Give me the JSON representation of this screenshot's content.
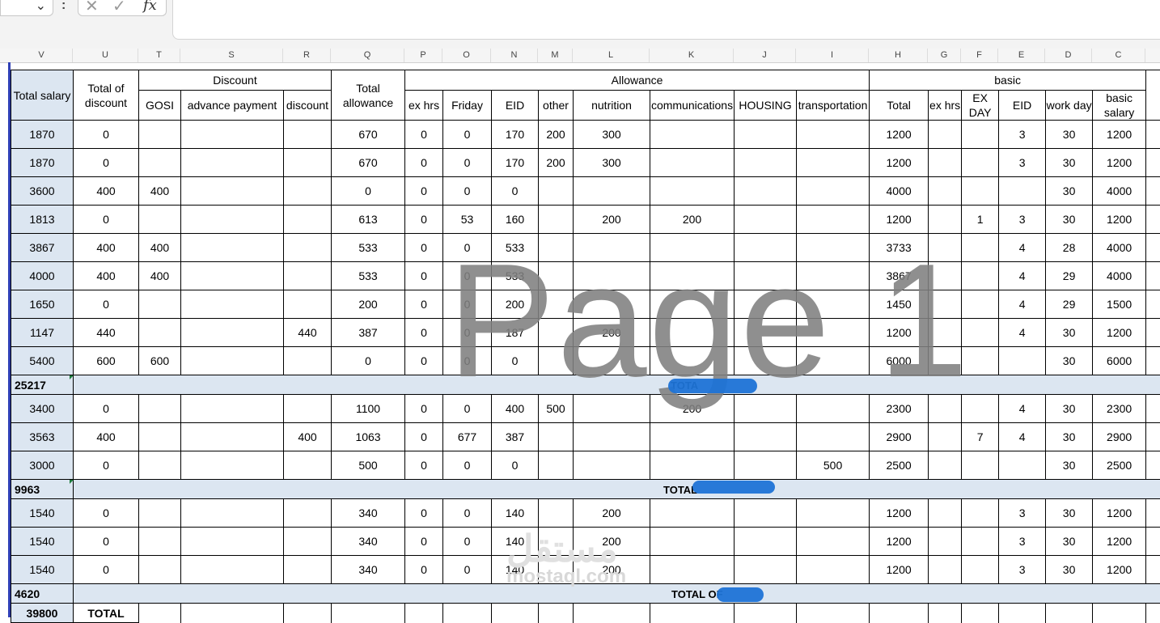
{
  "formula_bar": {
    "fx_label": "fx",
    "cancel_glyph": "✕",
    "enter_glyph": "✓",
    "name_box_value": ""
  },
  "columns": [
    "V",
    "U",
    "T",
    "S",
    "R",
    "Q",
    "P",
    "O",
    "N",
    "M",
    "L",
    "K",
    "J",
    "I",
    "H",
    "G",
    "F",
    "E",
    "D",
    "C"
  ],
  "headers": {
    "total_salary": "Total salary",
    "total_of_discount": "Total of discount",
    "discount_group": "Discount",
    "gosi": "GOSI",
    "advance_payment": "advance payment",
    "discount": "discount",
    "total_allowance": "Total allowance",
    "allowance_group": "Allowance",
    "ex_hrs": "ex hrs",
    "friday": "Friday",
    "eid": "EID",
    "other": "other",
    "nutrition": "nutrition",
    "communications": "communications",
    "housing": "HOUSING",
    "transportation": "transportation",
    "basic_group": "basic",
    "total": "Total",
    "ex_hrs_basic": "ex hrs",
    "ex_day": "EX DAY",
    "eid_basic": "EID",
    "work_day": "work day",
    "basic_salary": "basic salary"
  },
  "rows": [
    [
      "1870",
      "0",
      "",
      "",
      "",
      "670",
      "0",
      "0",
      "170",
      "200",
      "300",
      "",
      "",
      "",
      "1200",
      "",
      "",
      "3",
      "30",
      "1200"
    ],
    [
      "1870",
      "0",
      "",
      "",
      "",
      "670",
      "0",
      "0",
      "170",
      "200",
      "300",
      "",
      "",
      "",
      "1200",
      "",
      "",
      "3",
      "30",
      "1200"
    ],
    [
      "3600",
      "400",
      "400",
      "",
      "",
      "0",
      "0",
      "0",
      "0",
      "",
      "",
      "",
      "",
      "",
      "4000",
      "",
      "",
      "",
      "30",
      "4000"
    ],
    [
      "1813",
      "0",
      "",
      "",
      "",
      "613",
      "0",
      "53",
      "160",
      "",
      "200",
      "200",
      "",
      "",
      "1200",
      "",
      "1",
      "3",
      "30",
      "1200"
    ],
    [
      "3867",
      "400",
      "400",
      "",
      "",
      "533",
      "0",
      "0",
      "533",
      "",
      "",
      "",
      "",
      "",
      "3733",
      "",
      "",
      "4",
      "28",
      "4000"
    ],
    [
      "4000",
      "400",
      "400",
      "",
      "",
      "533",
      "0",
      "0",
      "533",
      "",
      "",
      "",
      "",
      "",
      "3867",
      "",
      "",
      "4",
      "29",
      "4000"
    ],
    [
      "1650",
      "0",
      "",
      "",
      "",
      "200",
      "0",
      "0",
      "200",
      "",
      "",
      "",
      "",
      "",
      "1450",
      "",
      "",
      "4",
      "29",
      "1500"
    ],
    [
      "1147",
      "440",
      "",
      "",
      "440",
      "387",
      "0",
      "0",
      "187",
      "",
      "200",
      "",
      "",
      "",
      "1200",
      "",
      "",
      "4",
      "30",
      "1200"
    ],
    [
      "5400",
      "600",
      "600",
      "",
      "",
      "0",
      "0",
      "0",
      "0",
      "",
      "",
      "",
      "",
      "",
      "6000",
      "",
      "",
      "",
      "30",
      "6000"
    ]
  ],
  "subtotal_1": {
    "sum": "25217",
    "label": "TOTA"
  },
  "rows_2": [
    [
      "3400",
      "0",
      "",
      "",
      "",
      "1100",
      "0",
      "0",
      "400",
      "500",
      "",
      "200",
      "",
      "",
      "2300",
      "",
      "",
      "4",
      "30",
      "2300"
    ],
    [
      "3563",
      "400",
      "",
      "",
      "400",
      "1063",
      "0",
      "677",
      "387",
      "",
      "",
      "",
      "",
      "",
      "2900",
      "",
      "7",
      "4",
      "30",
      "2900"
    ],
    [
      "3000",
      "0",
      "",
      "",
      "",
      "500",
      "0",
      "0",
      "0",
      "",
      "",
      "",
      "",
      "500",
      "2500",
      "",
      "",
      "",
      "30",
      "2500"
    ]
  ],
  "subtotal_2": {
    "sum": "9963",
    "label": "TOTAL"
  },
  "rows_3": [
    [
      "1540",
      "0",
      "",
      "",
      "",
      "340",
      "0",
      "0",
      "140",
      "",
      "200",
      "",
      "",
      "",
      "1200",
      "",
      "",
      "3",
      "30",
      "1200"
    ],
    [
      "1540",
      "0",
      "",
      "",
      "",
      "340",
      "0",
      "0",
      "140",
      "",
      "200",
      "",
      "",
      "",
      "1200",
      "",
      "",
      "3",
      "30",
      "1200"
    ],
    [
      "1540",
      "0",
      "",
      "",
      "",
      "340",
      "0",
      "0",
      "140",
      "",
      "200",
      "",
      "",
      "",
      "1200",
      "",
      "",
      "3",
      "30",
      "1200"
    ]
  ],
  "subtotal_3": {
    "sum": "4620",
    "label": "TOTAL OF"
  },
  "grand_total": {
    "sum": "39800",
    "label": "TOTAL"
  },
  "page_watermark": "Page 1",
  "brand_watermark": {
    "arabic": "مستقل",
    "latin": "mostaql.com"
  },
  "colors": {
    "selection": "#dce6f1",
    "redaction": "#1e73d6",
    "left_bar": "#2f3fb5"
  }
}
